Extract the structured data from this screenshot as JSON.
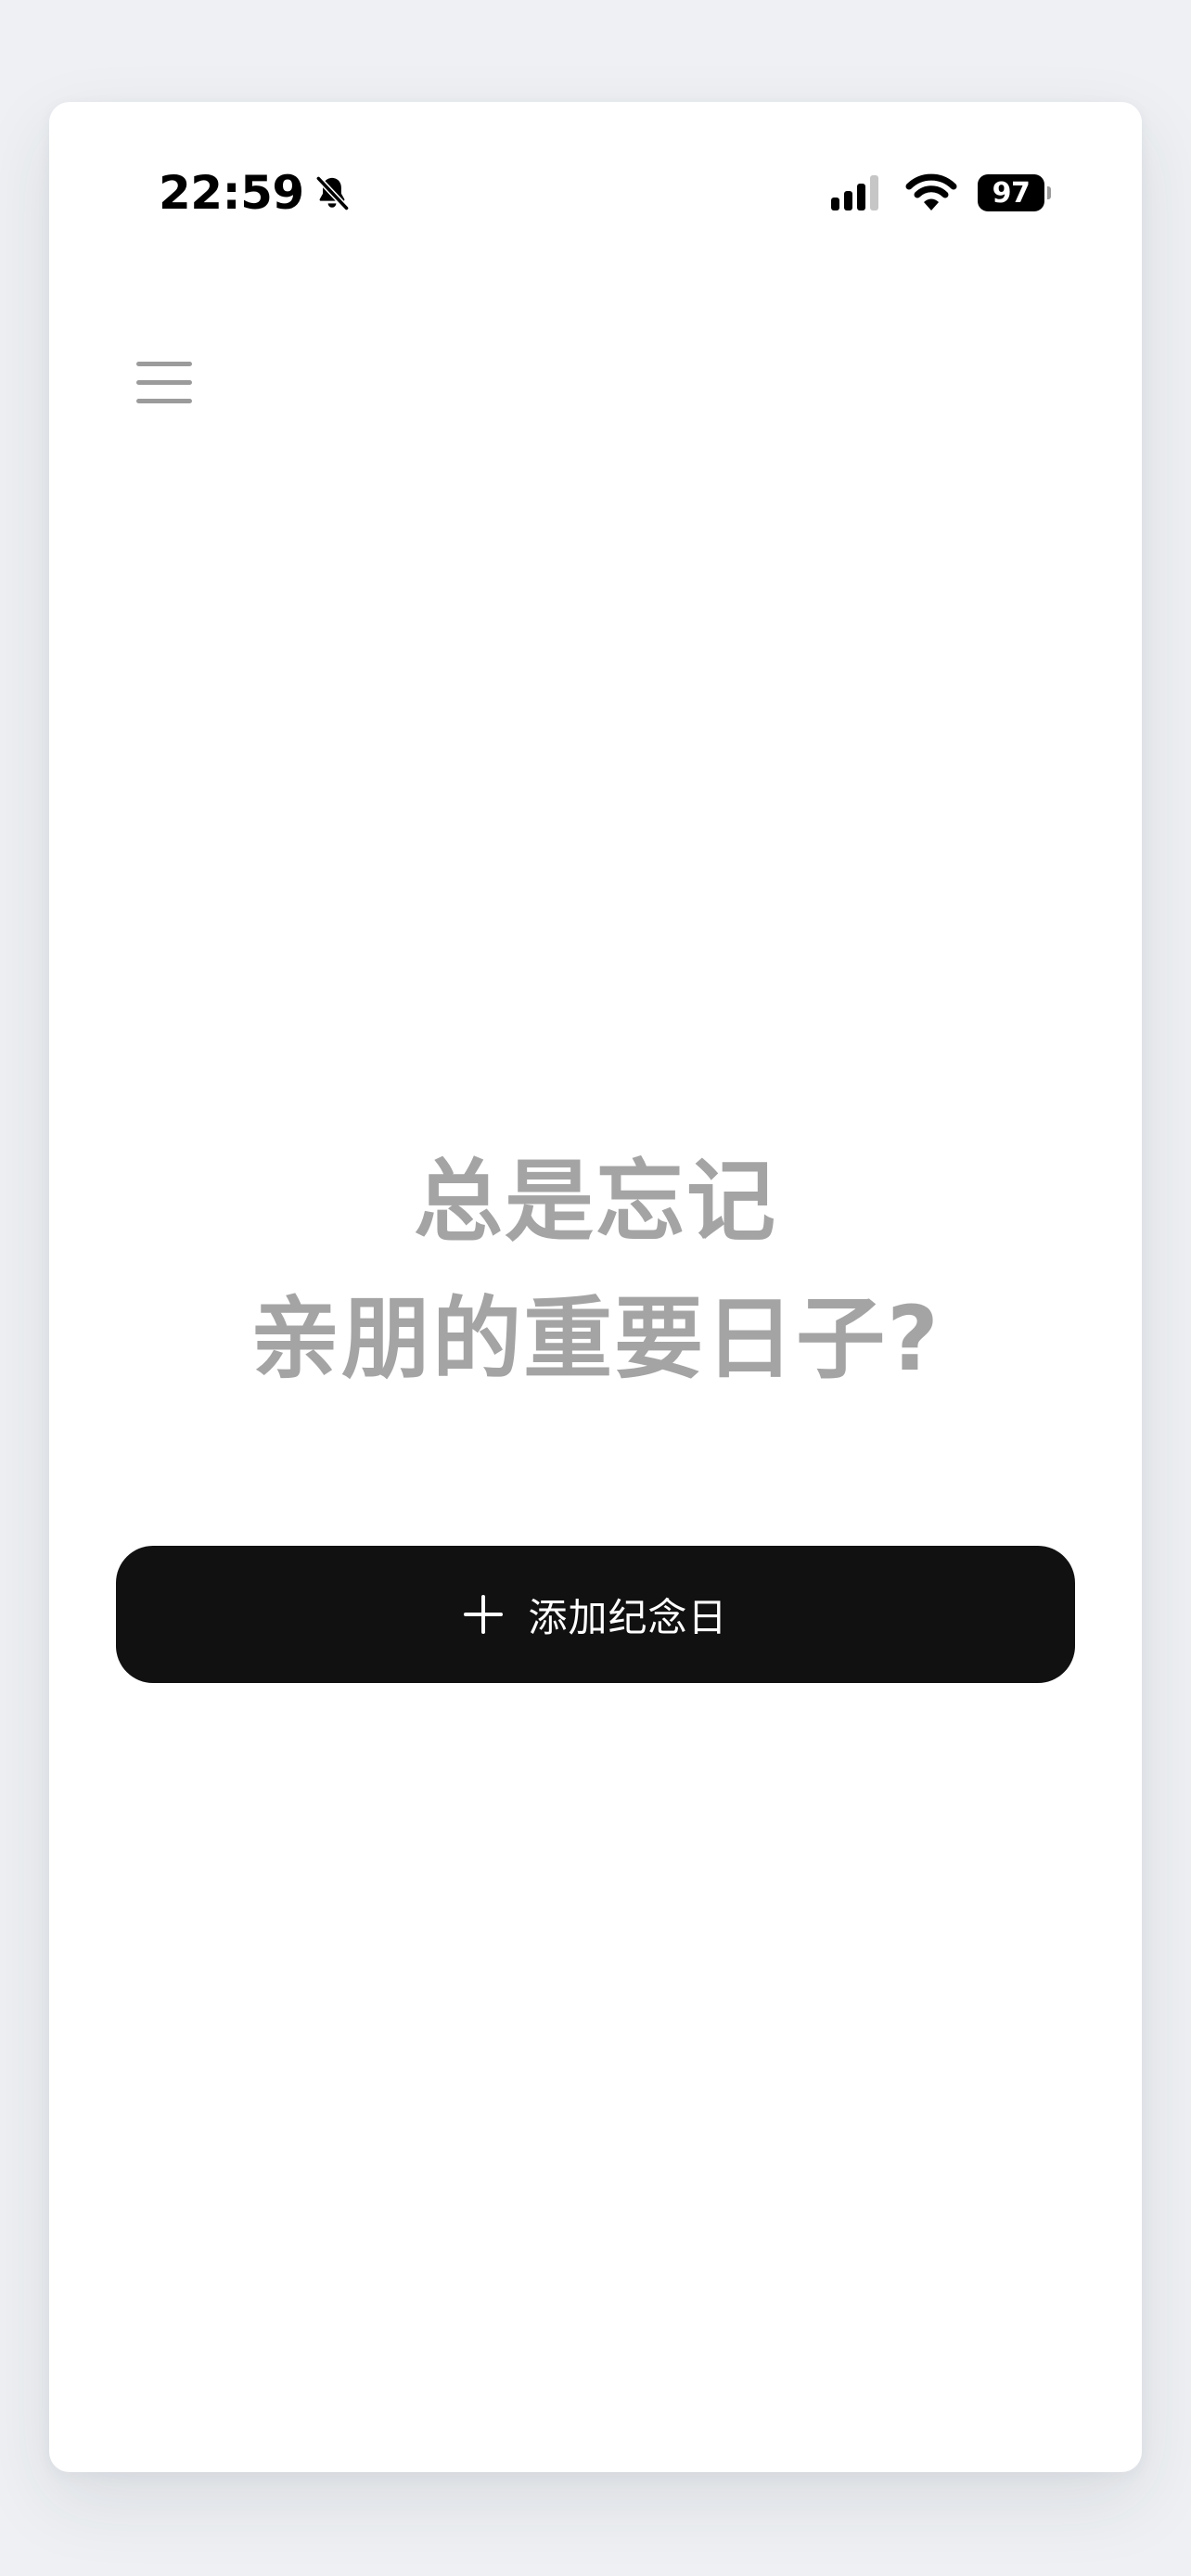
{
  "status_bar": {
    "time": "22:59",
    "silent_icon": "bell-slash-icon",
    "signal_icon": "cellular-signal-icon",
    "wifi_icon": "wifi-icon",
    "battery_level": "97"
  },
  "header": {
    "menu_icon": "hamburger-menu-icon"
  },
  "empty_state": {
    "line1": "总是忘记",
    "line2": "亲朋的重要日子?"
  },
  "add_button": {
    "icon": "plus-icon",
    "label": "添加纪念日"
  },
  "colors": {
    "background": "#ffffff",
    "headline_text": "#a4a4a4",
    "button_bg": "#111111",
    "button_text": "#ffffff",
    "menu_icon": "#9b9b9b"
  }
}
